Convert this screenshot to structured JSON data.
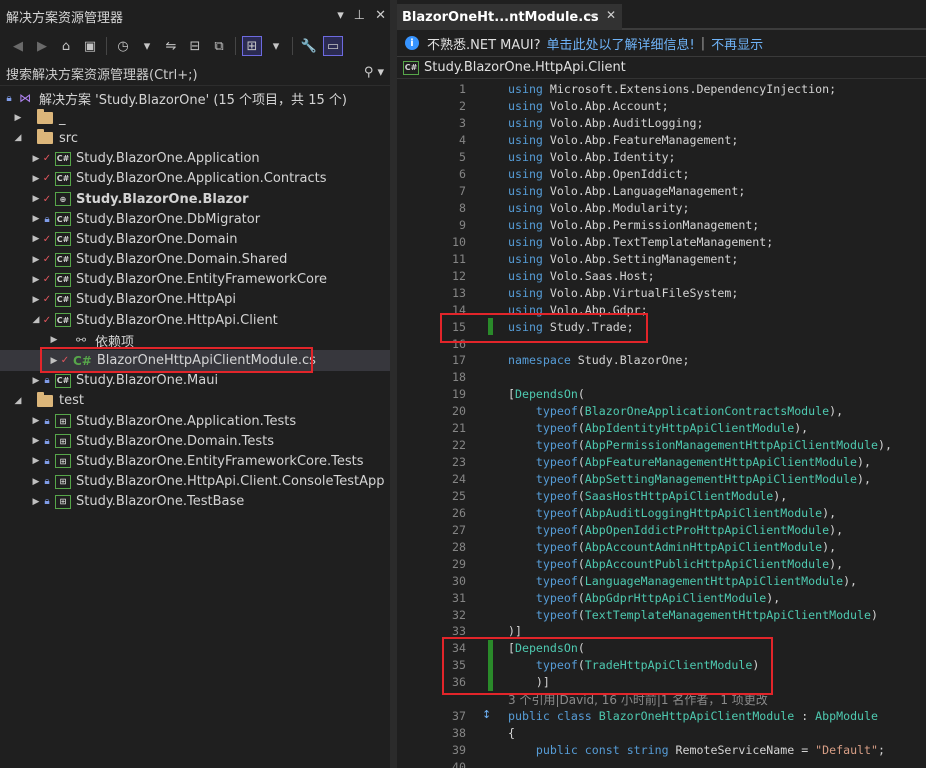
{
  "solution_explorer": {
    "title": "解决方案资源管理器",
    "search_placeholder": "搜索解决方案资源管理器(Ctrl+;)",
    "solution_label": "解决方案 'Study.BlazorOne' (15 个项目，共 15 个)",
    "folders": {
      "underscore": "_",
      "src": "src",
      "test": "test"
    },
    "projects_src": [
      {
        "name": "Study.BlazorOne.Application",
        "status": "check",
        "bold": false
      },
      {
        "name": "Study.BlazorOne.Application.Contracts",
        "status": "check",
        "bold": false
      },
      {
        "name": "Study.BlazorOne.Blazor",
        "status": "check",
        "bold": true
      },
      {
        "name": "Study.BlazorOne.DbMigrator",
        "status": "lock",
        "bold": false
      },
      {
        "name": "Study.BlazorOne.Domain",
        "status": "check",
        "bold": false
      },
      {
        "name": "Study.BlazorOne.Domain.Shared",
        "status": "check",
        "bold": false
      },
      {
        "name": "Study.BlazorOne.EntityFrameworkCore",
        "status": "check",
        "bold": false
      },
      {
        "name": "Study.BlazorOne.HttpApi",
        "status": "check",
        "bold": false
      },
      {
        "name": "Study.BlazorOne.HttpApi.Client",
        "status": "check",
        "bold": false
      }
    ],
    "dependencies_label": "依赖项",
    "selected_file": "BlazorOneHttpApiClientModule.cs",
    "maui_project": "Study.BlazorOne.Maui",
    "projects_test": [
      {
        "name": "Study.BlazorOne.Application.Tests"
      },
      {
        "name": "Study.BlazorOne.Domain.Tests"
      },
      {
        "name": "Study.BlazorOne.EntityFrameworkCore.Tests"
      },
      {
        "name": "Study.BlazorOne.HttpApi.Client.ConsoleTestApp"
      },
      {
        "name": "Study.BlazorOne.TestBase"
      }
    ]
  },
  "editor": {
    "tab_title": "BlazorOneHt...ntModule.cs",
    "info_message": "不熟悉.NET MAUI?",
    "info_link": "单击此处以了解详细信息!",
    "info_separator": "|",
    "info_dismiss": "不再显示",
    "nav_project": "Study.BlazorOne.HttpApi.Client",
    "codelens": "3 个引用|David, 16 小时前|1 名作者，1 项更改",
    "lines": [
      {
        "n": "1",
        "t": [
          [
            "kw",
            "using"
          ],
          [
            "txt",
            " Microsoft.Extensions.DependencyInjection;"
          ]
        ]
      },
      {
        "n": "2",
        "t": [
          [
            "kw",
            "using"
          ],
          [
            "txt",
            " Volo.Abp.Account;"
          ]
        ]
      },
      {
        "n": "3",
        "t": [
          [
            "kw",
            "using"
          ],
          [
            "txt",
            " Volo.Abp.AuditLogging;"
          ]
        ]
      },
      {
        "n": "4",
        "t": [
          [
            "kw",
            "using"
          ],
          [
            "txt",
            " Volo.Abp.FeatureManagement;"
          ]
        ]
      },
      {
        "n": "5",
        "t": [
          [
            "kw",
            "using"
          ],
          [
            "txt",
            " Volo.Abp.Identity;"
          ]
        ]
      },
      {
        "n": "6",
        "t": [
          [
            "kw",
            "using"
          ],
          [
            "txt",
            " Volo.Abp.OpenIddict;"
          ]
        ]
      },
      {
        "n": "7",
        "t": [
          [
            "kw",
            "using"
          ],
          [
            "txt",
            " Volo.Abp.LanguageManagement;"
          ]
        ]
      },
      {
        "n": "8",
        "t": [
          [
            "kw",
            "using"
          ],
          [
            "txt",
            " Volo.Abp.Modularity;"
          ]
        ]
      },
      {
        "n": "9",
        "t": [
          [
            "kw",
            "using"
          ],
          [
            "txt",
            " Volo.Abp.PermissionManagement;"
          ]
        ]
      },
      {
        "n": "10",
        "t": [
          [
            "kw",
            "using"
          ],
          [
            "txt",
            " Volo.Abp.TextTemplateManagement;"
          ]
        ]
      },
      {
        "n": "11",
        "t": [
          [
            "kw",
            "using"
          ],
          [
            "txt",
            " Volo.Abp.SettingManagement;"
          ]
        ]
      },
      {
        "n": "12",
        "t": [
          [
            "kw",
            "using"
          ],
          [
            "txt",
            " Volo.Saas.Host;"
          ]
        ]
      },
      {
        "n": "13",
        "t": [
          [
            "kw",
            "using"
          ],
          [
            "txt",
            " Volo.Abp.VirtualFileSystem;"
          ]
        ]
      },
      {
        "n": "14",
        "t": [
          [
            "kw",
            "using"
          ],
          [
            "txt",
            " Volo.Abp.Gdpr;"
          ]
        ]
      },
      {
        "n": "15",
        "t": [
          [
            "kw",
            "using"
          ],
          [
            "txt",
            " Study.Trade;"
          ]
        ],
        "changed": true
      },
      {
        "n": "16",
        "t": []
      },
      {
        "n": "17",
        "t": [
          [
            "kw",
            "namespace"
          ],
          [
            "txt",
            " Study.BlazorOne;"
          ]
        ]
      },
      {
        "n": "18",
        "t": []
      },
      {
        "n": "19",
        "t": [
          [
            "txt",
            "["
          ],
          [
            "ty",
            "DependsOn"
          ],
          [
            "txt",
            "("
          ]
        ]
      },
      {
        "n": "20",
        "t": [
          [
            "txt",
            "    "
          ],
          [
            "kw",
            "typeof"
          ],
          [
            "txt",
            "("
          ],
          [
            "ty",
            "BlazorOneApplicationContractsModule"
          ],
          [
            "txt",
            "),"
          ]
        ]
      },
      {
        "n": "21",
        "t": [
          [
            "txt",
            "    "
          ],
          [
            "kw",
            "typeof"
          ],
          [
            "txt",
            "("
          ],
          [
            "ty",
            "AbpIdentityHttpApiClientModule"
          ],
          [
            "txt",
            "),"
          ]
        ]
      },
      {
        "n": "22",
        "t": [
          [
            "txt",
            "    "
          ],
          [
            "kw",
            "typeof"
          ],
          [
            "txt",
            "("
          ],
          [
            "ty",
            "AbpPermissionManagementHttpApiClientModule"
          ],
          [
            "txt",
            "),"
          ]
        ]
      },
      {
        "n": "23",
        "t": [
          [
            "txt",
            "    "
          ],
          [
            "kw",
            "typeof"
          ],
          [
            "txt",
            "("
          ],
          [
            "ty",
            "AbpFeatureManagementHttpApiClientModule"
          ],
          [
            "txt",
            "),"
          ]
        ]
      },
      {
        "n": "24",
        "t": [
          [
            "txt",
            "    "
          ],
          [
            "kw",
            "typeof"
          ],
          [
            "txt",
            "("
          ],
          [
            "ty",
            "AbpSettingManagementHttpApiClientModule"
          ],
          [
            "txt",
            "),"
          ]
        ]
      },
      {
        "n": "25",
        "t": [
          [
            "txt",
            "    "
          ],
          [
            "kw",
            "typeof"
          ],
          [
            "txt",
            "("
          ],
          [
            "ty",
            "SaasHostHttpApiClientModule"
          ],
          [
            "txt",
            "),"
          ]
        ]
      },
      {
        "n": "26",
        "t": [
          [
            "txt",
            "    "
          ],
          [
            "kw",
            "typeof"
          ],
          [
            "txt",
            "("
          ],
          [
            "ty",
            "AbpAuditLoggingHttpApiClientModule"
          ],
          [
            "txt",
            "),"
          ]
        ]
      },
      {
        "n": "27",
        "t": [
          [
            "txt",
            "    "
          ],
          [
            "kw",
            "typeof"
          ],
          [
            "txt",
            "("
          ],
          [
            "ty",
            "AbpOpenIddictProHttpApiClientModule"
          ],
          [
            "txt",
            "),"
          ]
        ]
      },
      {
        "n": "28",
        "t": [
          [
            "txt",
            "    "
          ],
          [
            "kw",
            "typeof"
          ],
          [
            "txt",
            "("
          ],
          [
            "ty",
            "AbpAccountAdminHttpApiClientModule"
          ],
          [
            "txt",
            "),"
          ]
        ]
      },
      {
        "n": "29",
        "t": [
          [
            "txt",
            "    "
          ],
          [
            "kw",
            "typeof"
          ],
          [
            "txt",
            "("
          ],
          [
            "ty",
            "AbpAccountPublicHttpApiClientModule"
          ],
          [
            "txt",
            "),"
          ]
        ]
      },
      {
        "n": "30",
        "t": [
          [
            "txt",
            "    "
          ],
          [
            "kw",
            "typeof"
          ],
          [
            "txt",
            "("
          ],
          [
            "ty",
            "LanguageManagementHttpApiClientModule"
          ],
          [
            "txt",
            "),"
          ]
        ]
      },
      {
        "n": "31",
        "t": [
          [
            "txt",
            "    "
          ],
          [
            "kw",
            "typeof"
          ],
          [
            "txt",
            "("
          ],
          [
            "ty",
            "AbpGdprHttpApiClientModule"
          ],
          [
            "txt",
            "),"
          ]
        ]
      },
      {
        "n": "32",
        "t": [
          [
            "txt",
            "    "
          ],
          [
            "kw",
            "typeof"
          ],
          [
            "txt",
            "("
          ],
          [
            "ty",
            "TextTemplateManagementHttpApiClientModule"
          ],
          [
            "txt",
            ")"
          ]
        ]
      },
      {
        "n": "33",
        "t": [
          [
            "txt",
            ")]"
          ]
        ]
      },
      {
        "n": "34",
        "t": [
          [
            "txt",
            "["
          ],
          [
            "ty",
            "DependsOn"
          ],
          [
            "txt",
            "("
          ]
        ],
        "changed": true
      },
      {
        "n": "35",
        "t": [
          [
            "txt",
            "    "
          ],
          [
            "kw",
            "typeof"
          ],
          [
            "txt",
            "("
          ],
          [
            "ty",
            "TradeHttpApiClientModule"
          ],
          [
            "txt",
            ")"
          ]
        ],
        "changed": true
      },
      {
        "n": "36",
        "t": [
          [
            "txt",
            "    )]"
          ]
        ],
        "changed": true
      },
      {
        "n": "",
        "t": [
          [
            "cm",
            "3 个引用|David, 16 小时前|1 名作者，1 项更改"
          ]
        ],
        "codelens": true
      },
      {
        "n": "37",
        "t": [
          [
            "kw",
            "public"
          ],
          [
            "txt",
            " "
          ],
          [
            "kw",
            "class"
          ],
          [
            "txt",
            " "
          ],
          [
            "ty",
            "BlazorOneHttpApiClientModule"
          ],
          [
            "txt",
            " : "
          ],
          [
            "ty",
            "AbpModule"
          ]
        ],
        "classicon": true
      },
      {
        "n": "38",
        "t": [
          [
            "txt",
            "{"
          ]
        ]
      },
      {
        "n": "39",
        "t": [
          [
            "txt",
            "    "
          ],
          [
            "kw",
            "public"
          ],
          [
            "txt",
            " "
          ],
          [
            "kw",
            "const"
          ],
          [
            "txt",
            " "
          ],
          [
            "kw",
            "string"
          ],
          [
            "txt",
            " RemoteServiceName = "
          ],
          [
            "str",
            "\"Default\""
          ],
          [
            "txt",
            ";"
          ]
        ]
      },
      {
        "n": "40",
        "t": [
          [
            "txt",
            ""
          ]
        ]
      }
    ]
  },
  "colors": {
    "background": "#1f1f1f",
    "keyword": "#569cd6",
    "type": "#4ec9b0",
    "string": "#d69d85",
    "highlight_box": "#e2252a",
    "change_bar": "#2a8a2a"
  }
}
